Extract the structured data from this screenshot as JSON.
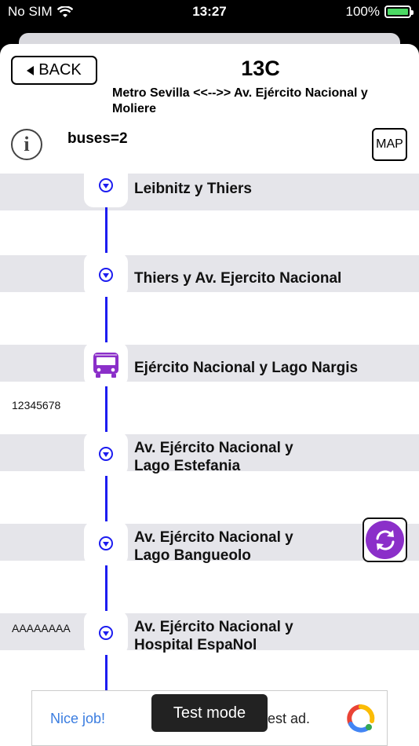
{
  "status_bar": {
    "carrier": "No SIM",
    "time": "13:27",
    "battery": "100%"
  },
  "header": {
    "back_label": "BACK",
    "route_number": "13C",
    "route_name": "Metro Sevilla <<-->> Av. Ejército Nacional y Moliere",
    "buses_text": "buses=2",
    "map_label": "MAP"
  },
  "stops": [
    {
      "name": "Leibnitz y Thiers"
    },
    {
      "name": "Thiers y Av. Ejercito Nacional"
    },
    {
      "name": "Ejército Nacional y Lago Nargis",
      "bus_id": "12345678"
    },
    {
      "name": "Av. Ejército Nacional y Lago Estefania"
    },
    {
      "name": "Av. Ejército Nacional y Lago Bangueolo"
    },
    {
      "name": "Av. Ejército Nacional y Hospital EspaNol"
    }
  ],
  "between_bus": {
    "bus_id": "AAAAAAAA"
  },
  "ad": {
    "left_text": "Nice job!",
    "right_text": "est ad.",
    "toast": "Test mode"
  },
  "colors": {
    "line": "#1c1cf0",
    "bus": "#8b2fc9",
    "band": "#e5e5ea"
  }
}
